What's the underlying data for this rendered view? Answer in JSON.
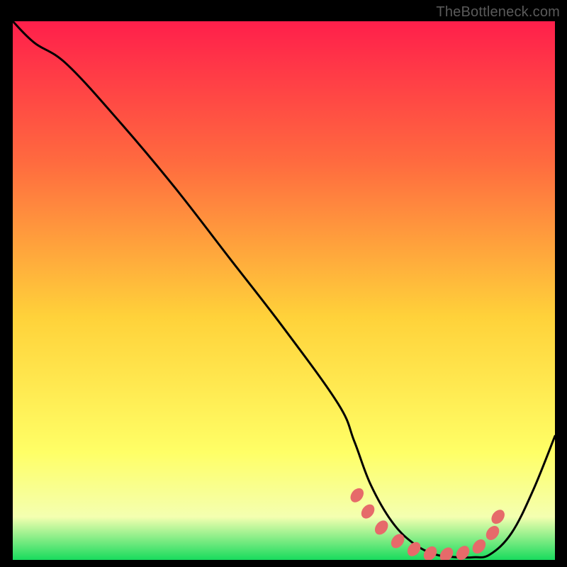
{
  "watermark": "TheBottleneck.com",
  "colors": {
    "bg": "#000000",
    "curve": "#000000",
    "markers": "#e66a6a",
    "grad_top": "#ff1f4b",
    "grad_mid1": "#ff6a3f",
    "grad_mid2": "#ffd23a",
    "grad_mid3": "#ffff66",
    "grad_mid4": "#f4ffb0",
    "grad_bottom": "#18db5d"
  },
  "chart_data": {
    "type": "line",
    "title": "",
    "xlabel": "",
    "ylabel": "",
    "xlim": [
      0,
      100
    ],
    "ylim": [
      0,
      100
    ],
    "series": [
      {
        "name": "bottleneck-curve",
        "x": [
          0,
          4,
          10,
          20,
          30,
          40,
          50,
          60,
          63,
          66,
          70,
          74,
          78,
          82,
          85,
          88,
          92,
          96,
          100
        ],
        "y": [
          100,
          96,
          92,
          81,
          69,
          56,
          43,
          29,
          22,
          14,
          7,
          3,
          1,
          0.5,
          0.5,
          1,
          5,
          13,
          23
        ]
      }
    ],
    "markers": {
      "name": "highlight-dots",
      "x": [
        63.5,
        65.5,
        68,
        71,
        74,
        77,
        80,
        83,
        86,
        88.5,
        89.5
      ],
      "y": [
        12,
        9,
        6,
        3.5,
        2,
        1.2,
        1,
        1.3,
        2.5,
        5,
        8
      ]
    }
  }
}
